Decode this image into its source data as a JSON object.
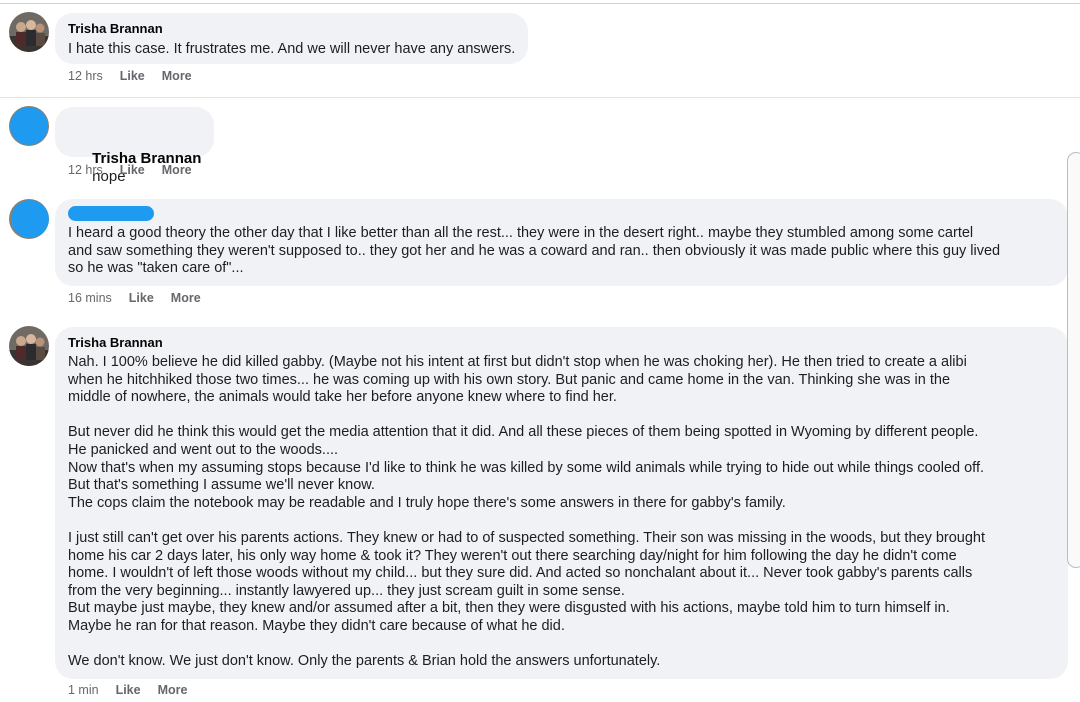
{
  "comments": [
    {
      "author": "Trisha Brannan",
      "text": "I hate this case. It frustrates me. And we will never have any answers.",
      "time": "12 hrs",
      "like": "Like",
      "more": "More"
    },
    {
      "mention": "Trisha Brannan",
      "text": "nope",
      "time": "12 hrs",
      "like": "Like",
      "more": "More"
    },
    {
      "text": "I heard a good theory the other day that I like better than all the rest... they were in the desert right.. maybe they stumbled among some cartel\nand saw something they weren't supposed to.. they got her and he was a coward and ran.. then obviously it was made public where this guy lived\nso he was \"taken care of\"...",
      "time": "16 mins",
      "like": "Like",
      "more": "More"
    },
    {
      "author": "Trisha Brannan",
      "text": "Nah. I 100% believe he did killed gabby. (Maybe not his intent at first but didn't stop when he was choking her). He then tried to create a alibi\nwhen he hitchhiked those two times... he was coming up with his own story. But panic and came home in the van. Thinking she was in the\nmiddle of nowhere, the animals would take her before anyone knew where to find her.\n\nBut never did he think this would get the media attention that it did. And all these pieces of them being spotted in Wyoming by different people.\nHe panicked and went out to the woods....\nNow that's when my assuming stops because I'd like to think he was killed by some wild animals while trying to hide out while things cooled off.\nBut that's something I assume we'll never know.\nThe cops claim the notebook may be readable and I truly hope there's some answers in there for gabby's family.\n\nI just still can't get over his parents actions. They knew or had to of suspected something. Their son was missing in the woods, but they brought\nhome his car 2 days later, his only way home & took it? They weren't out there searching day/night for him following the day he didn't come\nhome. I wouldn't of left those woods without my child... but they sure did. And acted so nonchalant about it... Never took gabby's parents calls\nfrom the very beginning... instantly lawyered up... they just scream guilt in some sense.\nBut maybe just maybe, they knew and/or assumed after a bit, then they were disgusted with his actions, maybe told him to turn himself in.\nMaybe he ran for that reason. Maybe they didn't care because of what he did.\n\nWe don't know. We just don't know. Only the parents & Brian hold the answers unfortunately.",
      "time": "1 min",
      "like": "Like",
      "more": "More"
    }
  ],
  "colors": {
    "bubble": "#f0f2f5",
    "redaction": "#1e9bf0",
    "meta": "#65676b"
  }
}
